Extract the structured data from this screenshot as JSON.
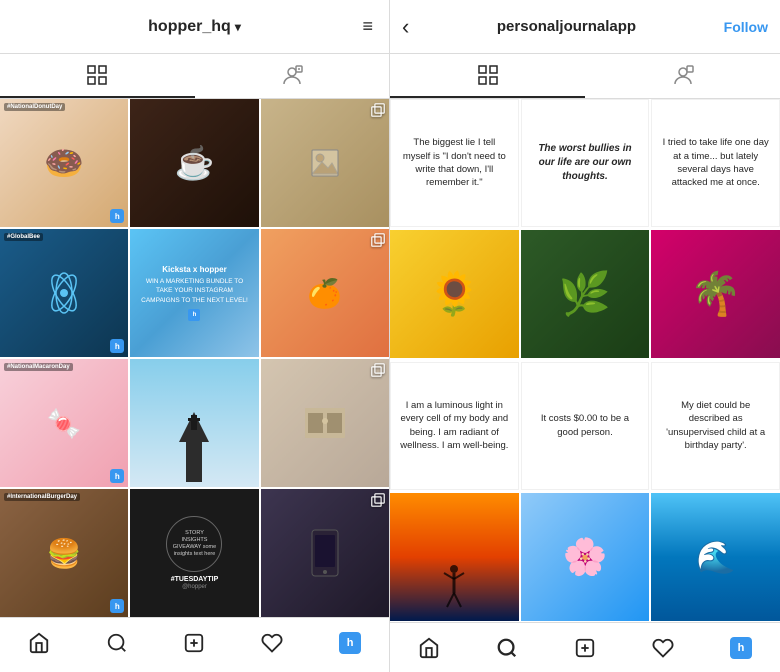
{
  "left": {
    "username": "hopper_hq",
    "username_chevron": "▾",
    "hamburger": "≡",
    "tabs": [
      {
        "name": "grid",
        "active": true
      },
      {
        "name": "tagged"
      }
    ],
    "grid_cells": [
      {
        "id": 1,
        "tag": "#NationalDonutDay",
        "type": "donut",
        "has_h": true
      },
      {
        "id": 2,
        "type": "coffee",
        "has_h": false
      },
      {
        "id": 3,
        "type": "art",
        "has_multi": true,
        "has_h": false
      },
      {
        "id": 4,
        "tag": "#GlobalBee",
        "type": "blue_science",
        "has_h": true
      },
      {
        "id": 5,
        "type": "kicksta",
        "has_h": false
      },
      {
        "id": 6,
        "type": "fruit",
        "has_multi": true,
        "has_h": false
      },
      {
        "id": 7,
        "tag": "#NationalMacaronDay",
        "type": "macaron",
        "has_h": true
      },
      {
        "id": 8,
        "type": "church",
        "has_h": false
      },
      {
        "id": 9,
        "type": "room",
        "has_multi": true,
        "has_h": false
      },
      {
        "id": 10,
        "tag": "#InternationalBurgerDay",
        "type": "burger",
        "has_h": true
      },
      {
        "id": 11,
        "type": "story_insights",
        "has_h": false
      },
      {
        "id": 12,
        "type": "dark_phone",
        "has_multi": true,
        "has_h": false
      }
    ],
    "nav": {
      "items": [
        "home",
        "search",
        "add",
        "heart",
        "profile_h"
      ]
    }
  },
  "right": {
    "username": "personaljournalapp",
    "follow_label": "Follow",
    "tabs": [
      {
        "name": "grid",
        "active": true
      },
      {
        "name": "tagged"
      }
    ],
    "grid_cells": [
      {
        "id": 1,
        "type": "quote",
        "text": "The biggest lie I tell myself is \"I don't need to write that down, I'll remember it.\"",
        "italic": false
      },
      {
        "id": 2,
        "type": "quote",
        "text": "The worst bullies in our life are our own thoughts.",
        "italic": true
      },
      {
        "id": 3,
        "type": "quote",
        "text": "I tried to take life one day at a time... but lately several days have attacked me at once.",
        "italic": false
      },
      {
        "id": 4,
        "type": "flower",
        "color": "#f4c430"
      },
      {
        "id": 5,
        "type": "green_leaf"
      },
      {
        "id": 6,
        "type": "palm_sunset"
      },
      {
        "id": 7,
        "type": "quote",
        "text": "I am a luminous light in every cell of my body and being. I am radiant of wellness. I am well-being.",
        "italic": false
      },
      {
        "id": 8,
        "type": "quote",
        "text": "It costs $0.00 to be a good person.",
        "italic": false
      },
      {
        "id": 9,
        "type": "quote",
        "text": "My diet could be described as 'unsupervised child at a birthday party'.",
        "italic": false
      },
      {
        "id": 10,
        "type": "sunset_person"
      },
      {
        "id": 11,
        "type": "flowers_white"
      },
      {
        "id": 12,
        "type": "ocean"
      }
    ],
    "nav": {
      "items": [
        "home",
        "search",
        "add",
        "heart",
        "profile_h"
      ]
    }
  }
}
